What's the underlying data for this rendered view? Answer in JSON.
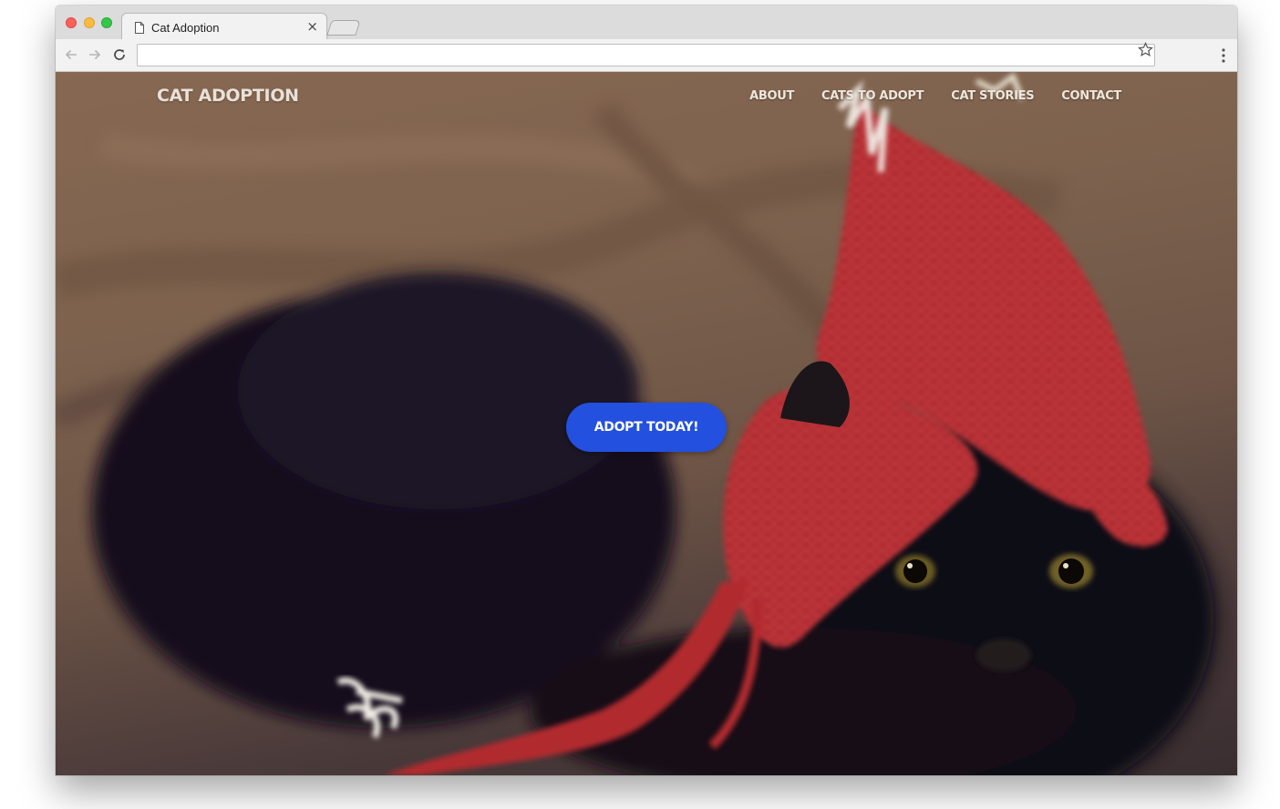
{
  "browser": {
    "tab_title": "Cat Adoption",
    "tab_close": "×",
    "address_value": ""
  },
  "site": {
    "brand": "CAT ADOPTION",
    "nav": [
      {
        "label": "ABOUT"
      },
      {
        "label": "CATS TO ADOPT"
      },
      {
        "label": "CAT STORIES"
      },
      {
        "label": "CONTACT"
      }
    ],
    "cta_label": "ADOPT TODAY!",
    "hero_subject": "black cat wearing red knitted hat on couch"
  },
  "colors": {
    "cta": "#2450e0",
    "hat": "#b3262e",
    "couch": "#7d624e"
  }
}
